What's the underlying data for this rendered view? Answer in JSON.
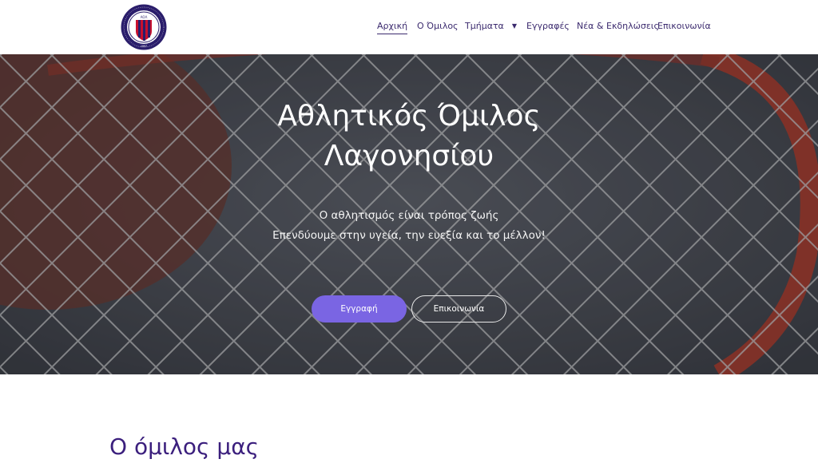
{
  "logo": {
    "ring_text": "ΑΘΛΗΤΙΚΟΣ ΟΜΙΛΟΣ ΛΑΓΟΝΗΣΙΟΥ",
    "initials": "ΑΟΛ",
    "year": "1997"
  },
  "nav": {
    "items": [
      {
        "label": "Αρχική",
        "active": true
      },
      {
        "label": "Ο Όμιλος"
      },
      {
        "label": "Τμήματα",
        "has_dropdown": true
      },
      {
        "label": "Εγγραφές"
      },
      {
        "label": "Νέα & Εκδηλώσεις"
      },
      {
        "label": "Επικοινωνία"
      }
    ],
    "dropdown_icon": "caret-down-icon"
  },
  "hero": {
    "title_line1": "Αθλητικός Όμιλος",
    "title_line2": "Λαγονησίου",
    "subtitle_line1": "Ο αθλητισμός είναι τρόπος ζωής",
    "subtitle_line2": "Επενδύουμε στην υγεία, την ευεξία και το μέλλον!",
    "primary_button": "Εγγραφή",
    "secondary_button": "Επικοινωνία"
  },
  "section": {
    "title": "Ο όμιλος μας"
  },
  "colors": {
    "brand_purple": "#3b2a6e",
    "button_purple": "#7a65e3",
    "heading_purple": "#3b1f7d",
    "logo_red": "#c8102e",
    "logo_navy": "#2a1d6b"
  }
}
